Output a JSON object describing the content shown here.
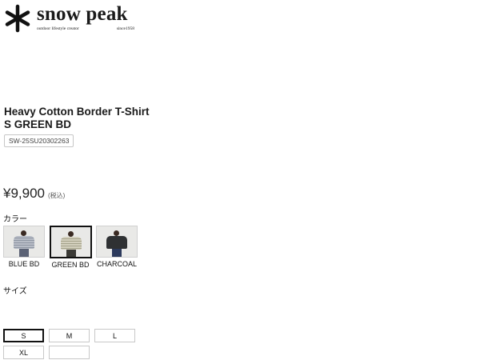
{
  "brand": {
    "name": "snow peak",
    "tagline": "outdoor lifestyle creator",
    "since": "since1958"
  },
  "product": {
    "title": "Heavy Cotton Border T-Shirt S GREEN BD",
    "sku": "SW-25SU20302263",
    "price": "¥9,900",
    "price_note": "(税込)"
  },
  "color_section": {
    "label": "カラー",
    "selected": "GREEN BD",
    "options": [
      {
        "name": "BLUE BD",
        "shirt_color": "#b7bcc6"
      },
      {
        "name": "GREEN BD",
        "shirt_color": "#cfcbb8"
      },
      {
        "name": "CHARCOAL",
        "shirt_color": "#2f3133"
      }
    ]
  },
  "size_section": {
    "label": "サイズ",
    "selected": "S",
    "options": [
      "S",
      "M",
      "L",
      "XL",
      ""
    ]
  },
  "colors": {
    "selected_border": "#111111",
    "default_border": "#c8c8c8"
  }
}
